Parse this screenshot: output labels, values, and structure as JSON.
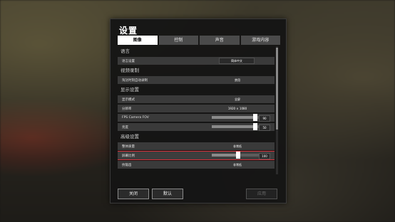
{
  "dialog": {
    "title": "设置",
    "tabs": [
      {
        "label": "图像",
        "active": true
      },
      {
        "label": "控制",
        "active": false
      },
      {
        "label": "声音",
        "active": false
      },
      {
        "label": "游戏内容",
        "active": false
      }
    ]
  },
  "sections": {
    "language": {
      "title": "语言",
      "rows": [
        {
          "label": "语言设置",
          "value": "简体中文"
        }
      ]
    },
    "video": {
      "title": "视频录制",
      "rows": [
        {
          "label": "淘汰时刻自动录制",
          "value": "禁用"
        }
      ]
    },
    "display": {
      "title": "显示设置",
      "rows": [
        {
          "label": "显示模式",
          "value": "全屏"
        },
        {
          "label": "分辨率",
          "value": "1920 × 1080"
        },
        {
          "label": "FPS Camera FOV",
          "value": "90",
          "level": 0.9
        },
        {
          "label": "亮度",
          "value": "50",
          "level": 0.9
        }
      ]
    },
    "advanced": {
      "title": "高级设置",
      "rows": [
        {
          "label": "整体质量",
          "value": "非常低"
        },
        {
          "label": "屏幕比例",
          "value": "100",
          "level": 0.55
        },
        {
          "label": "抗锯齿",
          "value": "非常低"
        }
      ]
    }
  },
  "footer": {
    "close_label": "关闭",
    "default_label": "默认",
    "apply_label": "应用"
  },
  "colors": {
    "highlight": "#d8313a",
    "active_tab_bg": "#ffffff",
    "panel_bg": "#141414"
  }
}
